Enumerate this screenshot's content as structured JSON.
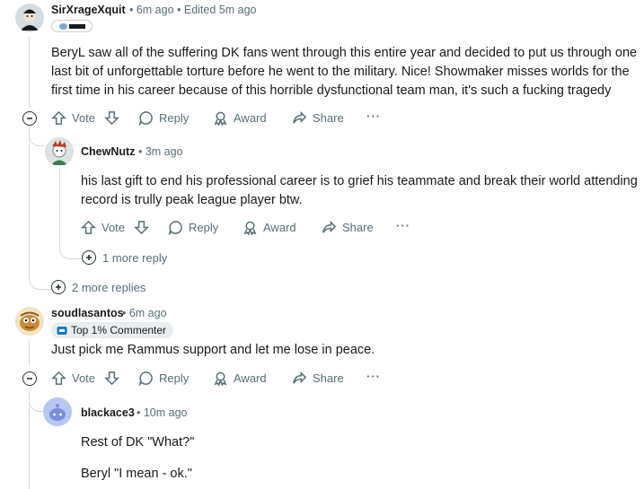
{
  "comments": [
    {
      "username": "SirXrageXquit",
      "meta": "• 6m ago • Edited 5m ago",
      "body": "BeryL saw all of the suffering DK fans went through this entire year and decided to put us through one last bit of unforgettable torture before he went to the military. Nice! Showmaker misses worlds for the first time in his career because of this horrible dysfunctional team man, it's such a fucking tragedy"
    },
    {
      "username": "ChewNutz",
      "meta": "• 3m ago",
      "body": "his last gift to end his professional career is to grief his teammate and break their world attending record is trully peak league player btw."
    },
    {
      "username": "soudlasantos",
      "meta": "• 6m ago",
      "flair": "Top 1% Commenter",
      "body": "Just pick me Rammus support and let me lose in peace."
    },
    {
      "username": "blackace3",
      "meta": "• 10m ago",
      "body_lines": [
        "Rest of DK \"What?\"",
        "Beryl \"I mean - ok.\""
      ]
    }
  ],
  "actions": {
    "vote": "Vote",
    "reply": "Reply",
    "award": "Award",
    "share": "Share",
    "overflow": "···"
  },
  "expanders": {
    "one_more_reply": "1 more reply",
    "two_more_replies": "2 more replies"
  },
  "icons": [
    "upvote-icon",
    "downvote-icon",
    "reply-icon",
    "award-icon",
    "share-icon",
    "overflow-icon",
    "collapse-icon",
    "expand-icon",
    "flair-badge-icon"
  ]
}
